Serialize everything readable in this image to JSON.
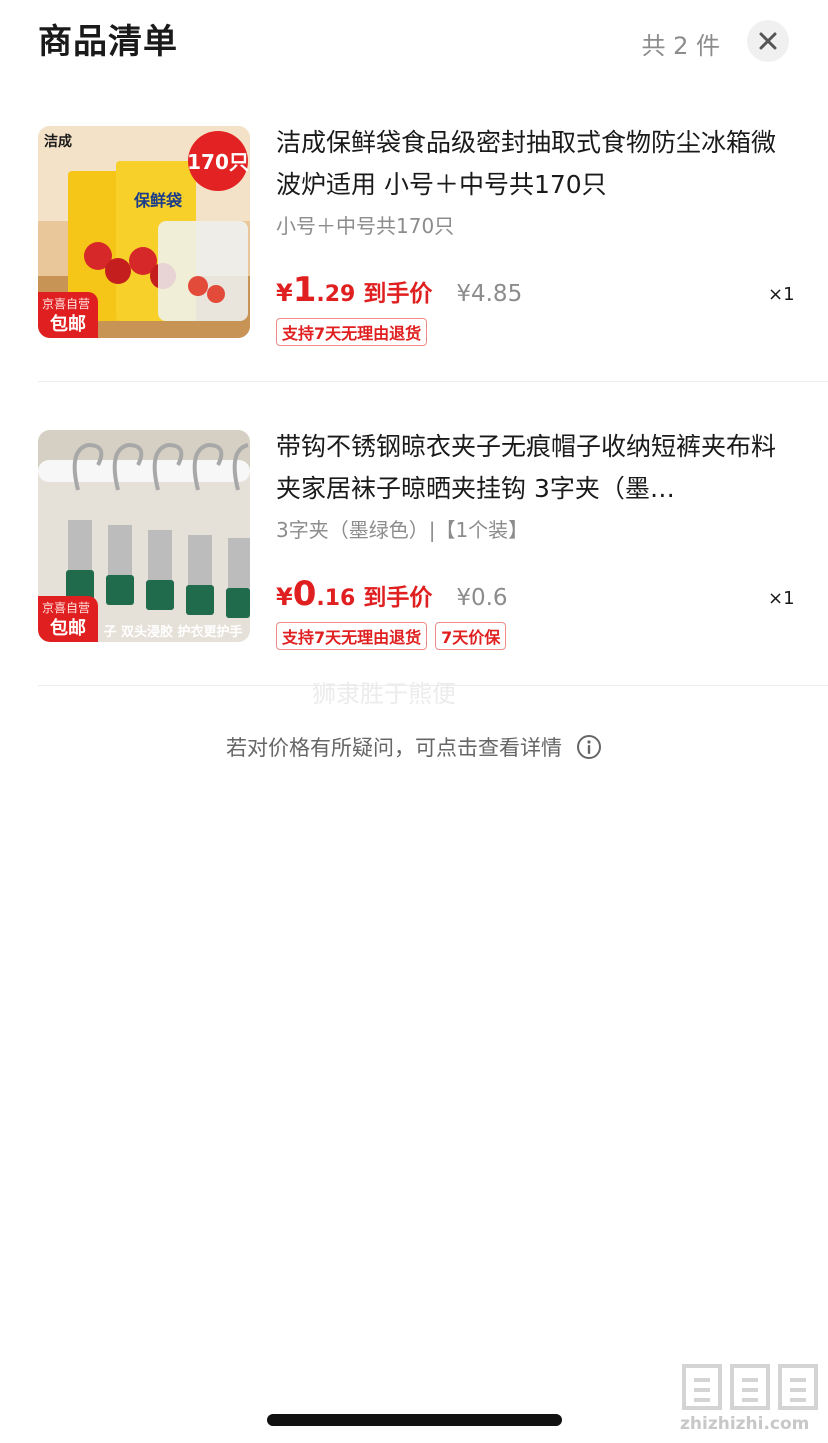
{
  "header": {
    "title": "商品清单",
    "count": "共 2 件",
    "close_icon": "close-icon"
  },
  "items": [
    {
      "name": "洁成保鲜袋食品级密封抽取式食物防尘冰箱微波炉适用 小号＋中号共170只",
      "spec": "小号＋中号共170只",
      "price_currency": "¥",
      "price_int": "1",
      "price_dec": ".29",
      "price_label": "到手价",
      "orig_price": "¥4.85",
      "qty": "×1",
      "tags": [
        "支持7天无理由退货"
      ],
      "badge_top": "京喜自营",
      "badge_main": "包邮",
      "thumb_brand": "洁成",
      "thumb_count": "170只",
      "thumb_product": "保鲜袋"
    },
    {
      "name": "带钩不锈钢晾衣夹子无痕帽子收纳短裤夹布料夹家居袜子晾晒夹挂钩 3字夹（墨…",
      "spec": "3字夹（墨绿色）|【1个装】",
      "price_currency": "¥",
      "price_int": "0",
      "price_dec": ".16",
      "price_label": "到手价",
      "orig_price": "¥0.6",
      "qty": "×1",
      "tags": [
        "支持7天无理由退货",
        "7天价保"
      ],
      "badge_top": "京喜自营",
      "badge_main": "包邮",
      "thumb_caption": "子 双头浸胶 护衣更护手"
    }
  ],
  "watermark": "狮隶胜于熊便",
  "footer_hint": "若对价格有所疑问，可点击查看详情",
  "site_url": "zhizhizhi.com",
  "colors": {
    "accent_red": "#e02020",
    "muted_gray": "#8c8c8c"
  }
}
